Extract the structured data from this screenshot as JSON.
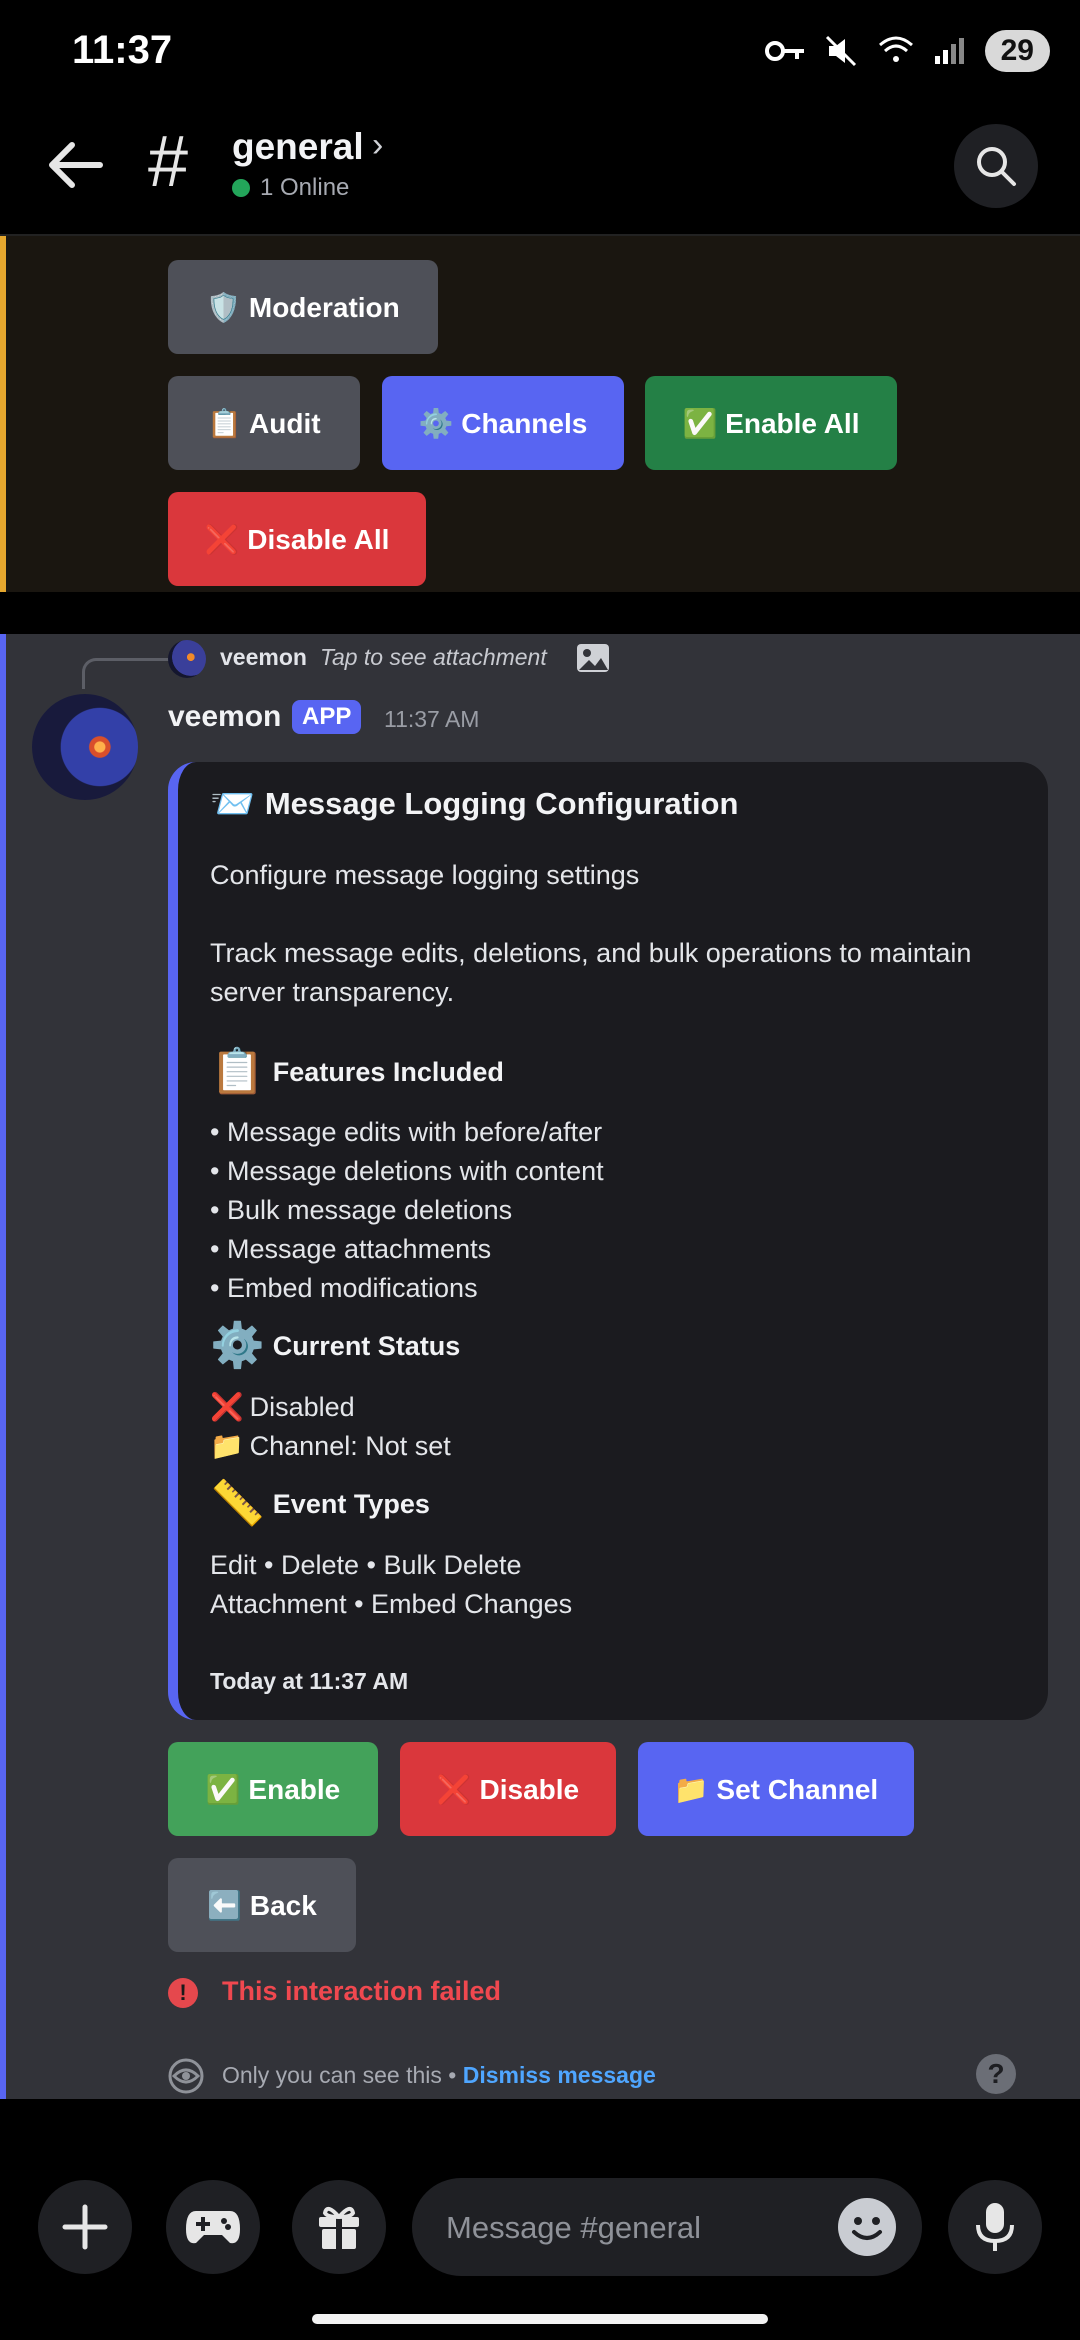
{
  "status_bar": {
    "time": "11:37",
    "battery": "29"
  },
  "header": {
    "channel": "general",
    "online": "1 Online"
  },
  "top_embed": {
    "buttons": {
      "moderation": "🛡️ Moderation",
      "audit": "📋 Audit",
      "channels": "⚙️ Channels",
      "enable_all": "✅ Enable All",
      "disable_all": "❌ Disable All"
    }
  },
  "reply": {
    "name": "veemon",
    "text": "Tap to see attachment"
  },
  "message": {
    "author": "veemon",
    "tag": "APP",
    "time": "11:37 AM",
    "embed": {
      "title_icon": "📨",
      "title": "Message Logging Configuration",
      "description": "Configure message logging settings",
      "detail": "Track message edits, deletions, and bulk operations to maintain server transparency.",
      "features_icon": "📋",
      "features_title": "Features Included",
      "features": [
        "• Message edits with before/after",
        "• Message deletions with content",
        "• Bulk message deletions",
        "• Message attachments",
        "• Embed modifications"
      ],
      "status_icon": "⚙️",
      "status_title": "Current Status",
      "status_line1_icon": "❌",
      "status_line1": "Disabled",
      "status_line2_icon": "📁",
      "status_line2": "Channel: Not set",
      "event_icon": "📏",
      "event_title": "Event Types",
      "event_line1": "Edit • Delete • Bulk Delete",
      "event_line2": "Attachment • Embed Changes",
      "footer": "Today at 11:37 AM"
    },
    "buttons": {
      "enable": "✅ Enable",
      "disable": "❌ Disable",
      "set_channel": "📁 Set Channel",
      "back": "⬅️ Back"
    },
    "error": "This interaction failed",
    "ephemeral_text": "Only you can see this • ",
    "dismiss": "Dismiss message"
  },
  "composer": {
    "placeholder": "Message #general"
  }
}
